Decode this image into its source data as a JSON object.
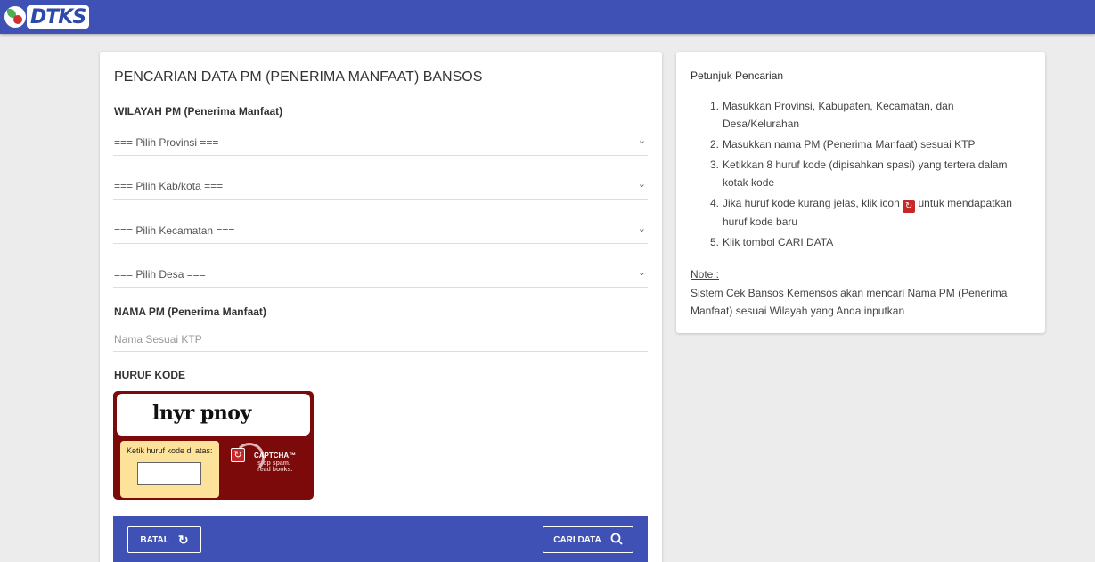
{
  "header": {
    "logo_text": "DTKS"
  },
  "main": {
    "title": "PENCARIAN DATA PM (PENERIMA MANFAAT) BANSOS",
    "wilayah_label": "WILAYAH PM (Penerima Manfaat)",
    "selects": {
      "provinsi": "=== Pilih Provinsi ===",
      "kabkota": "=== Pilih Kab/kota ===",
      "kecamatan": "=== Pilih Kecamatan ===",
      "desa": "=== Pilih Desa ==="
    },
    "nama_label": "NAMA PM (Penerima Manfaat)",
    "nama_placeholder": "Nama Sesuai KTP",
    "kode_label": "HURUF KODE",
    "captcha": {
      "text": "lnyr pnoy",
      "input_label": "Ketik huruf kode di atas:",
      "brand": "CAPTCHA™",
      "tagline_1": "stop spam.",
      "tagline_2": "read books."
    },
    "buttons": {
      "batal": "BATAL",
      "cari": "CARI DATA"
    }
  },
  "side": {
    "title": "Petunjuk Pencarian",
    "steps": [
      "Masukkan Provinsi, Kabupaten, Kecamatan, dan Desa/Kelurahan",
      "Masukkan nama PM (Penerima Manfaat) sesuai KTP",
      "Ketikkan 8 huruf kode (dipisahkan spasi) yang tertera dalam kotak kode",
      "Jika huruf kode kurang jelas, klik icon",
      "Klik tombol CARI DATA"
    ],
    "step4_suffix": "untuk mendapatkan huruf kode baru",
    "note_label": "Note :",
    "note_text": "Sistem Cek Bansos Kemensos akan mencari Nama PM (Penerima Manfaat) sesuai Wilayah yang Anda inputkan"
  },
  "colors": {
    "primary": "#3f51b5",
    "captcha_bg": "#7d0a0a",
    "captcha_box": "#fde39a"
  }
}
